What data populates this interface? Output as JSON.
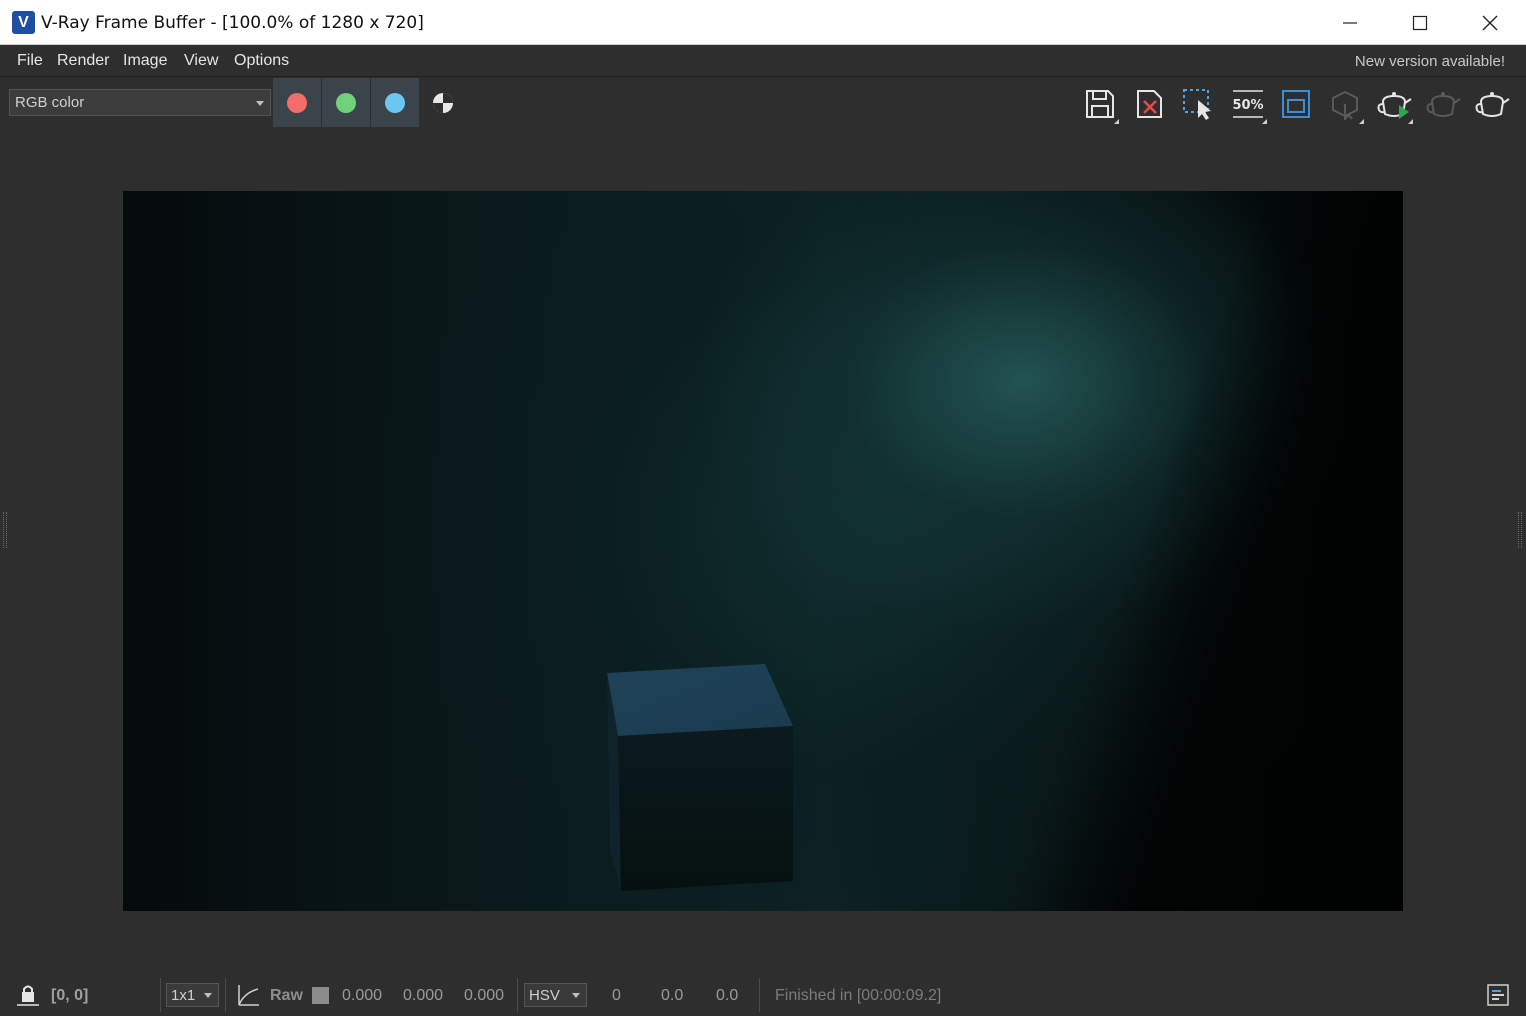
{
  "window": {
    "title": "V-Ray Frame Buffer - [100.0% of 1280 x 720]",
    "app_icon_glyph": "V"
  },
  "menu": {
    "items": [
      "File",
      "Render",
      "Image",
      "View",
      "Options"
    ],
    "new_version": "New version available!"
  },
  "toolbar": {
    "channel": "RGB color",
    "channel_colors": {
      "red": "#f36b6b",
      "green": "#6fd27a",
      "blue": "#6cc6f2"
    },
    "right_icons": [
      "save-icon",
      "clear-image-icon",
      "region-render-icon",
      "zoom-50-icon",
      "show-history-icon",
      "interactive-render-icon",
      "start-render-icon",
      "stop-render-icon",
      "render-teapot-icon"
    ],
    "zoom_label": "50%"
  },
  "status": {
    "coords": "[0, 0]",
    "sample_size": "1x1",
    "raw_label": "Raw",
    "rgb": [
      "0.000",
      "0.000",
      "0.000"
    ],
    "color_mode": "HSV",
    "hsv": [
      "0",
      "0.0",
      "0.0"
    ],
    "finished": "Finished in [00:00:09.2]"
  }
}
